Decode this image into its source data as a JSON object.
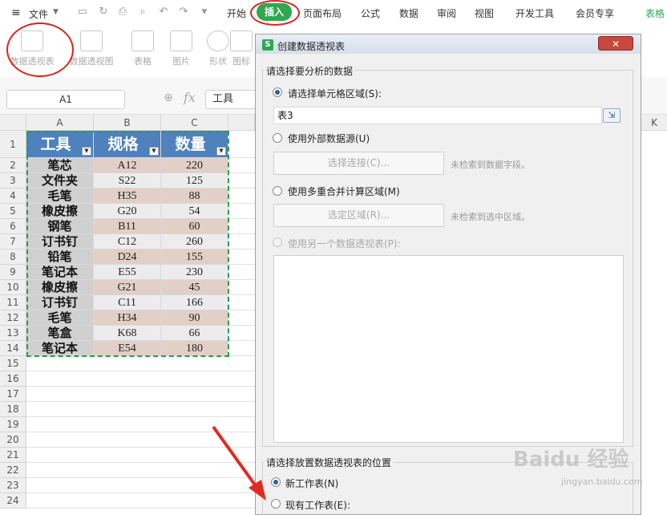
{
  "menubar": {
    "file_menu": "文件",
    "tabs": [
      "开始",
      "插入",
      "页面布局",
      "公式",
      "数据",
      "审阅",
      "视图",
      "开发工具",
      "会员专享",
      "表格"
    ],
    "active_tab": "插入"
  },
  "ribbon": {
    "buttons": [
      "数据透视表",
      "数据透视图",
      "表格",
      "图片",
      "形状",
      "图标"
    ]
  },
  "formula_bar": {
    "name_box": "A1",
    "fx_label": "fx",
    "content": "工具"
  },
  "sheet": {
    "columns": [
      "A",
      "B",
      "C"
    ],
    "extra_column": "K",
    "rows": [
      "1",
      "2",
      "3",
      "4",
      "5",
      "6",
      "7",
      "8",
      "9",
      "10",
      "11",
      "12",
      "13",
      "14",
      "15",
      "16",
      "17",
      "18",
      "19",
      "20",
      "21",
      "22",
      "23",
      "24"
    ],
    "headers": [
      "工具",
      "规格",
      "数量"
    ],
    "data": [
      [
        "笔芯",
        "A12",
        "220"
      ],
      [
        "文件夹",
        "S22",
        "125"
      ],
      [
        "毛笔",
        "H35",
        "88"
      ],
      [
        "橡皮擦",
        "G20",
        "54"
      ],
      [
        "钢笔",
        "B11",
        "60"
      ],
      [
        "订书钉",
        "C12",
        "260"
      ],
      [
        "铅笔",
        "D24",
        "155"
      ],
      [
        "笔记本",
        "E55",
        "230"
      ],
      [
        "橡皮擦",
        "G21",
        "45"
      ],
      [
        "订书钉",
        "C11",
        "166"
      ],
      [
        "毛笔",
        "H34",
        "90"
      ],
      [
        "笔盒",
        "K68",
        "66"
      ],
      [
        "笔记本",
        "E54",
        "180"
      ]
    ]
  },
  "dialog": {
    "title": "创建数据透视表",
    "close_icon": "✕",
    "section1_title": "请选择要分析的数据",
    "option_range": "请选择单元格区域(S):",
    "range_value": "表3",
    "option_external": "使用外部数据源(U)",
    "select_connection": "选择连接(C)...",
    "no_fields_hint": "未检索到数据字段。",
    "option_multi": "使用多重合并计算区域(M)",
    "select_area": "选定区域(R)...",
    "no_area_hint": "未检索到选中区域。",
    "option_other_pivot": "使用另一个数据透视表(P):",
    "section2_title": "请选择放置数据透视表的位置",
    "option_new_sheet": "新工作表(N)",
    "option_existing_sheet": "现有工作表(E):"
  },
  "watermark": {
    "main": "Baidu 经验",
    "sub": "jingyan.baidu.com"
  },
  "colors": {
    "header_blue": "#4f81bd",
    "accent_green": "#2fa84f",
    "annotation_red": "#d9251d"
  }
}
